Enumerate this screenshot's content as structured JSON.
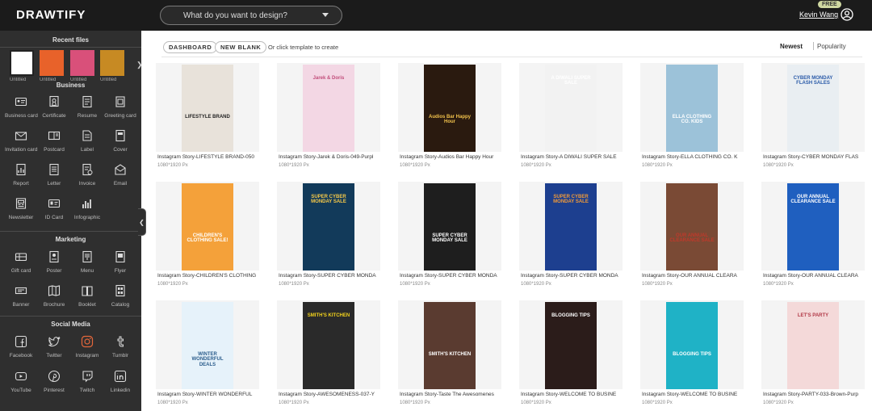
{
  "header": {
    "logo": "DRAWTIFY",
    "search_placeholder": "What do you want to design?",
    "badge": "FREE",
    "user": "Kevin Wang"
  },
  "sidebar": {
    "recent_title": "Recent files",
    "recent": [
      {
        "label": "Untitled",
        "color": "#ffffff"
      },
      {
        "label": "Untitled",
        "color": "#e8622a"
      },
      {
        "label": "Untitled",
        "color": "#d9507a"
      },
      {
        "label": "Untitled",
        "color": "#c78a23"
      }
    ],
    "sections": [
      {
        "title": "Business",
        "items": [
          "Business card",
          "Certificate",
          "Resume",
          "Greeting card",
          "Invitation card",
          "Postcard",
          "Label",
          "Cover",
          "Report",
          "Letter",
          "Invoice",
          "Email",
          "Newsletter",
          "ID Card",
          "Infographic"
        ]
      },
      {
        "title": "Marketing",
        "items": [
          "Gift card",
          "Poster",
          "Menu",
          "Flyer",
          "Banner",
          "Brochure",
          "Booklet",
          "Catalog"
        ]
      },
      {
        "title": "Social Media",
        "items": [
          "Facebook",
          "Twitter",
          "Instagram",
          "Tumblr",
          "YouTube",
          "Pinterest",
          "Twitch",
          "Linkedin"
        ]
      }
    ]
  },
  "toolbar": {
    "dashboard": "DASHBOARD",
    "new_blank": "NEW BLANK",
    "hint": "Or click template to create",
    "sort_newest": "Newest",
    "sort_popularity": "Popularity"
  },
  "templates": [
    {
      "title": "Instagram Story-LIFESTYLE BRAND-050",
      "size": "1080*1920 Px",
      "bg": "#e8e2da",
      "text": "LIFESTYLE BRAND",
      "fg": "#222"
    },
    {
      "title": "Instagram Story-Jarek & Doris-049-Purpl",
      "size": "1080*1920 Px",
      "bg": "#f3d7e4",
      "text": "Jarek & Doris",
      "fg": "#c24d7a"
    },
    {
      "title": "Instagram Story-Audios Bar Happy Hour",
      "size": "1080*1920 Px",
      "bg": "#2a1a0f",
      "text": "Audios Bar Happy Hour",
      "fg": "#f0c14b"
    },
    {
      "title": "Instagram Story-A DIWALI SUPER SALE",
      "size": "1080*1920 Px",
      "bg": "#f2f2f2",
      "text": "A DIWALI SUPER SALE",
      "fg": "#ffffff"
    },
    {
      "title": "Instagram Story-ELLA CLOTHING CO. K",
      "size": "1080*1920 Px",
      "bg": "#9cc2d9",
      "text": "ELLA CLOTHING CO. KIDS",
      "fg": "#ffffff"
    },
    {
      "title": "Instagram Story-CYBER MONDAY FLAS",
      "size": "1080*1920 Px",
      "bg": "#e9eef2",
      "text": "CYBER MONDAY FLASH SALES",
      "fg": "#2a5aa8"
    },
    {
      "title": "Instagram Story-CHILDREN'S CLOTHING",
      "size": "1080*1920 Px",
      "bg": "#f4a13a",
      "text": "CHILDREN'S CLOTHING SALE!",
      "fg": "#ffffff"
    },
    {
      "title": "Instagram Story-SUPER CYBER MONDA",
      "size": "1080*1920 Px",
      "bg": "#123a5a",
      "text": "SUPER CYBER MONDAY SALE",
      "fg": "#f7c948"
    },
    {
      "title": "Instagram Story-SUPER CYBER MONDA",
      "size": "1080*1920 Px",
      "bg": "#1e1e1e",
      "text": "SUPER CYBER MONDAY SALE",
      "fg": "#ffffff"
    },
    {
      "title": "Instagram Story-SUPER CYBER MONDA",
      "size": "1080*1920 Px",
      "bg": "#1d3f8f",
      "text": "SUPER CYBER MONDAY SALE",
      "fg": "#f29b38"
    },
    {
      "title": "Instagram Story-OUR ANNUAL CLEARA",
      "size": "1080*1920 Px",
      "bg": "#7a4a35",
      "text": "OUR ANNUAL CLEARANCE SALE",
      "fg": "#c0392b"
    },
    {
      "title": "Instagram Story-OUR ANNUAL CLEARA",
      "size": "1080*1920 Px",
      "bg": "#1f5fbf",
      "text": "OUR ANNUAL CLEARANCE SALE",
      "fg": "#ffffff"
    },
    {
      "title": "Instagram Story-WINTER WONDERFUL",
      "size": "1080*1920 Px",
      "bg": "#e6f2fa",
      "text": "WINTER WONDERFUL DEALS",
      "fg": "#2b5d8c"
    },
    {
      "title": "Instagram Story-AWESOMENESS-037-Y",
      "size": "1080*1920 Px",
      "bg": "#2a2a2a",
      "text": "SMITH'S KITCHEN",
      "fg": "#f2d21c"
    },
    {
      "title": "Instagram Story-Taste The Awesomenes",
      "size": "1080*1920 Px",
      "bg": "#5a3b30",
      "text": "SMITH'S KITCHEN",
      "fg": "#ffffff"
    },
    {
      "title": "Instagram Story-WELCOME TO BUSINE",
      "size": "1080*1920 Px",
      "bg": "#2b1c1a",
      "text": "BLOGGING TIPS",
      "fg": "#ffffff"
    },
    {
      "title": "Instagram Story-WELCOME TO BUSINE",
      "size": "1080*1920 Px",
      "bg": "#1fb2c6",
      "text": "BLOGGING TIPS",
      "fg": "#ffffff"
    },
    {
      "title": "Instagram Story-PARTY-033-Brown-Purp",
      "size": "1080*1920 Px",
      "bg": "#f4d9d9",
      "text": "LET'S PARTY",
      "fg": "#b23a48"
    }
  ]
}
